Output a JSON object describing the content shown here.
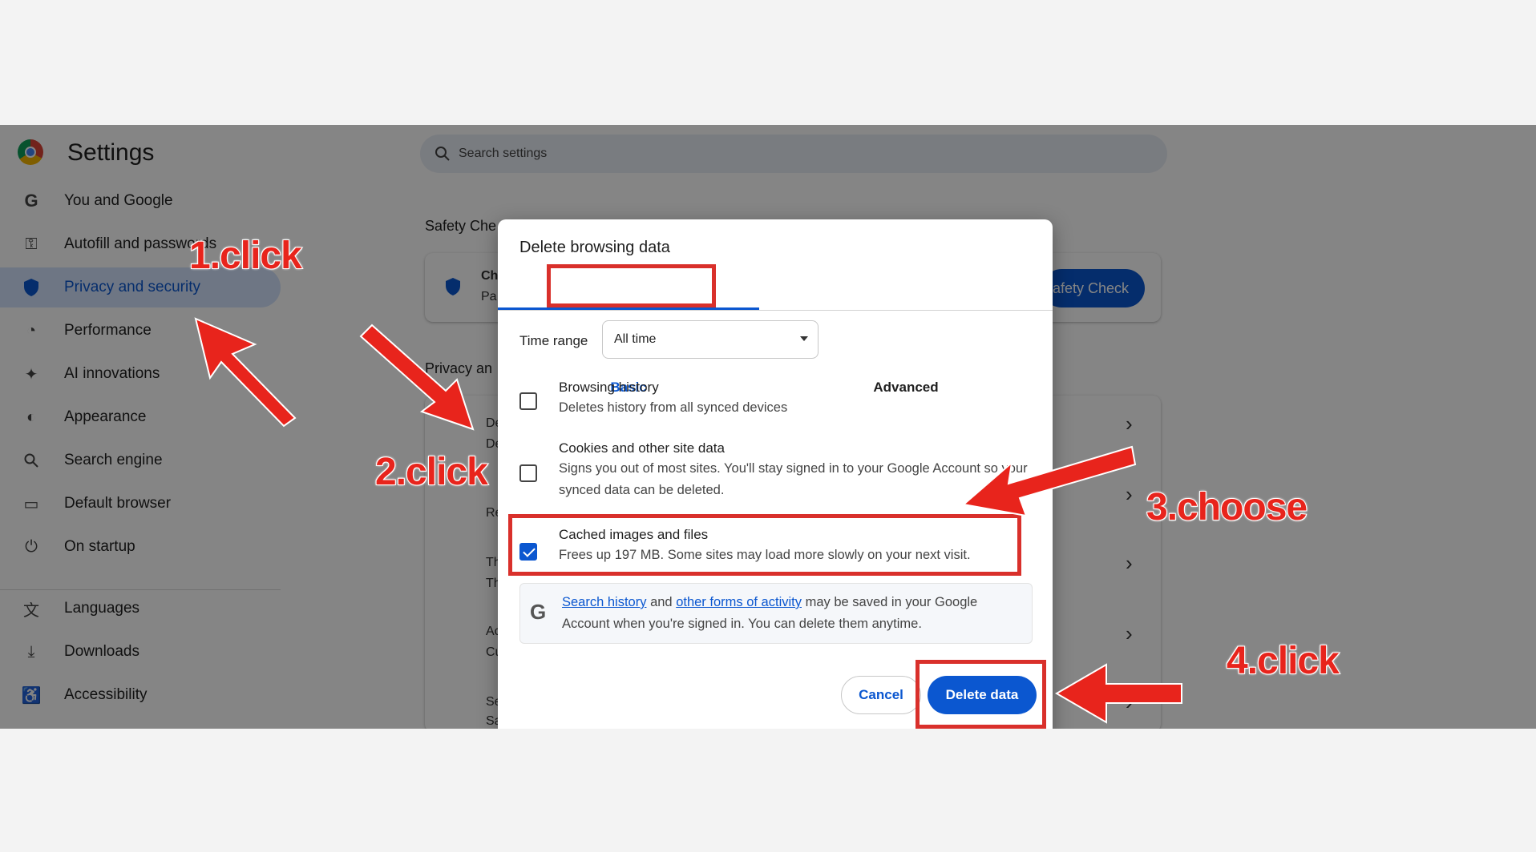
{
  "settings": {
    "title": "Settings",
    "search_placeholder": "Search settings",
    "nav": [
      {
        "label": "You and Google",
        "icon": "google-g-icon"
      },
      {
        "label": "Autofill and passwords",
        "icon": "key-icon"
      },
      {
        "label": "Privacy and security",
        "icon": "shield-icon"
      },
      {
        "label": "Performance",
        "icon": "gauge-icon"
      },
      {
        "label": "AI innovations",
        "icon": "sparkle-icon"
      },
      {
        "label": "Appearance",
        "icon": "palette-icon"
      },
      {
        "label": "Search engine",
        "icon": "search-icon"
      },
      {
        "label": "Default browser",
        "icon": "browser-window-icon"
      },
      {
        "label": "On startup",
        "icon": "power-icon"
      },
      {
        "label": "Languages",
        "icon": "translate-icon"
      },
      {
        "label": "Downloads",
        "icon": "download-icon"
      },
      {
        "label": "Accessibility",
        "icon": "accessibility-icon"
      }
    ],
    "safety_check_heading": "Safety Che",
    "safety_check_button": "afety Check",
    "privacy_heading": "Privacy an",
    "bg_fragments": [
      "Ch",
      "Pa",
      "De",
      "De",
      "Th",
      "Th",
      "Re",
      "Ac",
      "Cu",
      "Se",
      "Sa"
    ]
  },
  "dialog": {
    "title": "Delete browsing data",
    "tabs": {
      "basic": "Basic",
      "advanced": "Advanced"
    },
    "time_range": {
      "label": "Time range",
      "value": "All time"
    },
    "options": [
      {
        "title": "Browsing history",
        "desc": "Deletes history from all synced devices",
        "checked": false
      },
      {
        "title": "Cookies and other site data",
        "desc": "Signs you out of most sites. You'll stay signed in to your Google Account so your synced data can be deleted.",
        "checked": false
      },
      {
        "title": "Cached images and files",
        "desc": "Frees up 197 MB. Some sites may load more slowly on your next visit.",
        "checked": true
      }
    ],
    "google_info": {
      "link1": "Search history",
      "and": "and",
      "link2": "other forms of activity",
      "rest": "may be saved in your Google Account when you're signed in. You can delete them anytime."
    },
    "cancel": "Cancel",
    "delete": "Delete data"
  },
  "annotations": {
    "step1": "1.click",
    "step2": "2.click",
    "step3": "3.choose",
    "step4": "4.click",
    "color": "#e8241c"
  }
}
